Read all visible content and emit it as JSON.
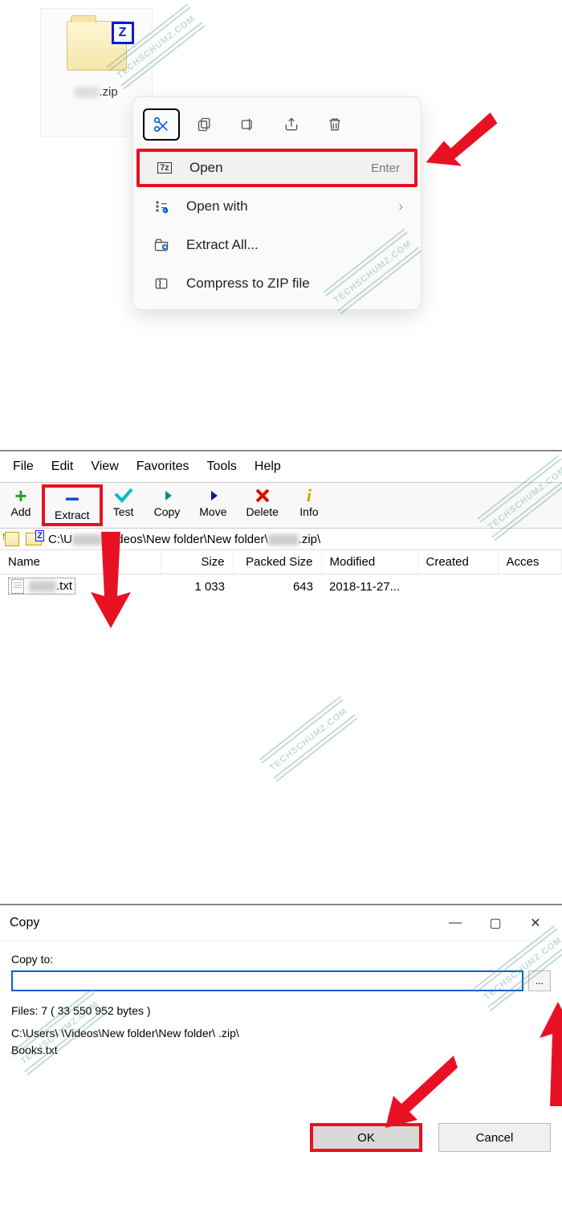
{
  "watermark_text": "TECHSCHUMZ.COM",
  "section1": {
    "file_ext": ".zip",
    "context_menu": {
      "open": {
        "label": "Open",
        "shortcut": "Enter"
      },
      "open_with": {
        "label": "Open with"
      },
      "extract_all": {
        "label": "Extract All..."
      },
      "compress": {
        "label": "Compress to ZIP file"
      }
    }
  },
  "section2": {
    "menubar": {
      "file": "File",
      "edit": "Edit",
      "view": "View",
      "favorites": "Favorites",
      "tools": "Tools",
      "help": "Help"
    },
    "toolbar": {
      "add": "Add",
      "extract": "Extract",
      "test": "Test",
      "copy": "Copy",
      "move": "Move",
      "delete": "Delete",
      "info": "Info"
    },
    "path_prefix": "C:\\U",
    "path_mid": "\\Videos\\New folder\\New folder\\",
    "path_suffix": ".zip\\",
    "columns": {
      "name": "Name",
      "size": "Size",
      "packed": "Packed Size",
      "modified": "Modified",
      "created": "Created",
      "access": "Acces"
    },
    "rows": [
      {
        "name_suffix": ".txt",
        "size": "1 033",
        "packed": "643",
        "modified": "2018-11-27..."
      }
    ]
  },
  "section3": {
    "title": "Copy",
    "copy_to_label": "Copy to:",
    "files_info": "Files: 7 ( 33 550 952 bytes )",
    "path_line": "C:\\Users\\      \\Videos\\New folder\\New folder\\        .zip\\",
    "books_line": "Books.txt",
    "ok": "OK",
    "cancel": "Cancel",
    "browse": "..."
  }
}
